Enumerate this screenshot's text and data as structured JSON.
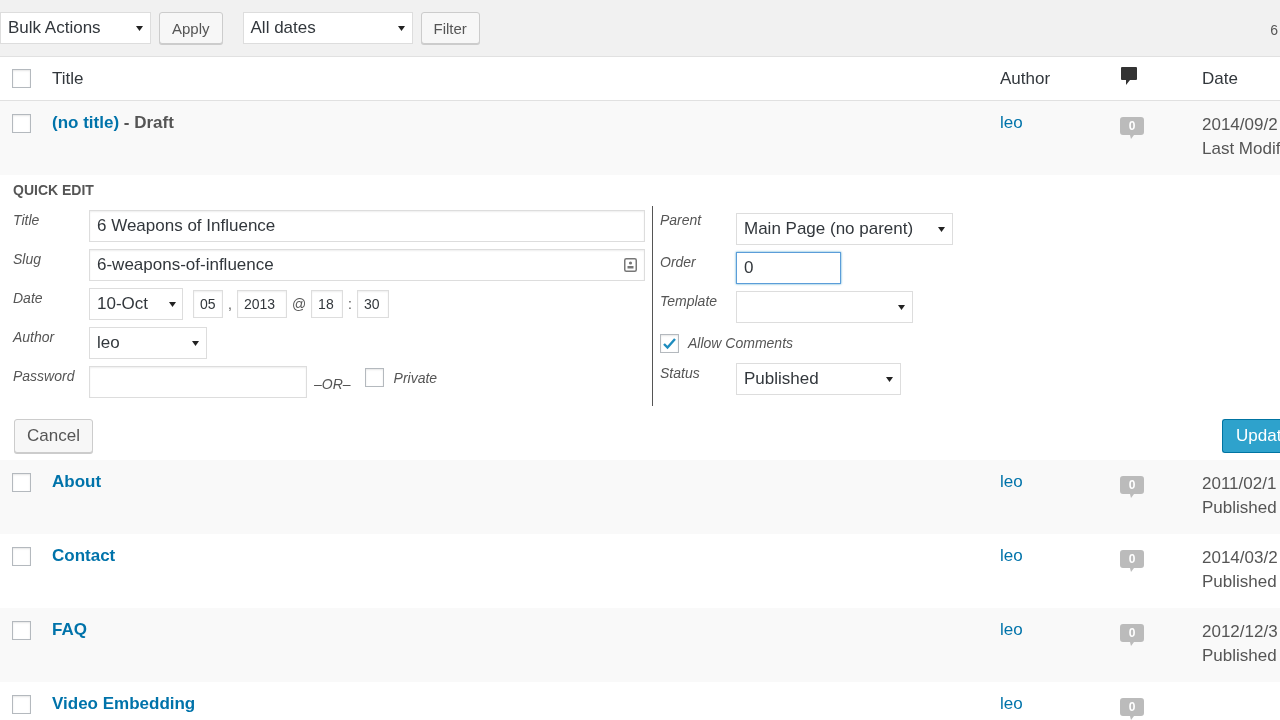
{
  "toolbar": {
    "bulk_actions": "Bulk Actions",
    "apply": "Apply",
    "dates": "All dates",
    "filter": "Filter",
    "count": "6"
  },
  "columns": {
    "title": "Title",
    "author": "Author",
    "date": "Date",
    "checked": false
  },
  "rows": [
    {
      "kind": "post",
      "title": "(no title)",
      "suffix": " - Draft",
      "author": "leo",
      "comments": "0",
      "date": "2014/09/2",
      "status": "Last Modif",
      "checked": false
    },
    {
      "kind": "quick_edit",
      "heading": "QUICK EDIT",
      "title_label": "Title",
      "title_value": "6 Weapons of Influence",
      "slug_label": "Slug",
      "slug_value": "6-weapons-of-influence",
      "date_label": "Date",
      "month": "10-Oct",
      "day": "05",
      "comma": ",",
      "year": "2013",
      "at": "@",
      "hour": "18",
      "colon": ":",
      "minute": "30",
      "author_label": "Author",
      "author_value": "leo",
      "password_label": "Password",
      "or": "–OR–",
      "private_label": "Private",
      "private_checked": false,
      "parent_label": "Parent",
      "parent_value": "Main Page (no parent)",
      "order_label": "Order",
      "order_value": "0",
      "order_focused": true,
      "template_label": "Template",
      "comments_label": "Allow Comments",
      "comments_checked": true,
      "status_label": "Status",
      "status_value": "Published",
      "cancel": "Cancel",
      "update": "Updat"
    },
    {
      "kind": "post",
      "title": "About",
      "author": "leo",
      "comments": "0",
      "date": "2011/02/1",
      "status": "Published",
      "checked": false
    },
    {
      "kind": "post",
      "title": "Contact",
      "author": "leo",
      "comments": "0",
      "date": "2014/03/2",
      "status": "Published",
      "checked": false
    },
    {
      "kind": "post",
      "title": "FAQ",
      "author": "leo",
      "comments": "0",
      "date": "2012/12/3",
      "status": "Published",
      "checked": false
    },
    {
      "kind": "post",
      "title": "Video Embedding",
      "author": "leo",
      "comments": "0",
      "checked": false
    }
  ]
}
